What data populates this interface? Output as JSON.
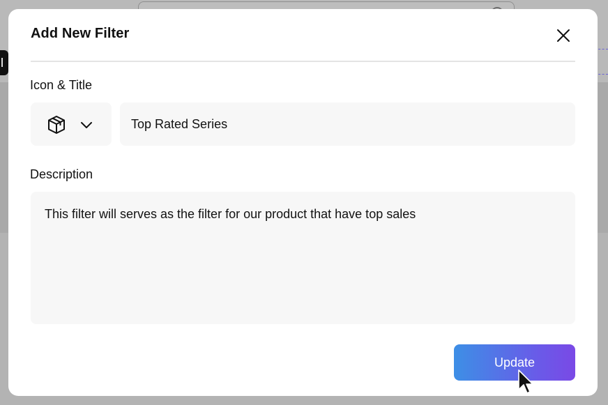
{
  "modal": {
    "title": "Add New Filter",
    "icon_title_label": "Icon & Title",
    "selected_icon": "box-icon",
    "title_value": "Top Rated Series",
    "description_label": "Description",
    "description_value": "This filter will serves as the filter for our product that have top sales",
    "update_label": "Update"
  },
  "icons": {
    "close": "close-icon",
    "dropdown": "chevron-down-icon",
    "cursor": "mouse-pointer-icon"
  },
  "colors": {
    "button_gradient_start": "#3d8fe6",
    "button_gradient_end": "#7a49e6",
    "field_background": "#f7f7f7",
    "overlay": "#a9a9a9"
  }
}
